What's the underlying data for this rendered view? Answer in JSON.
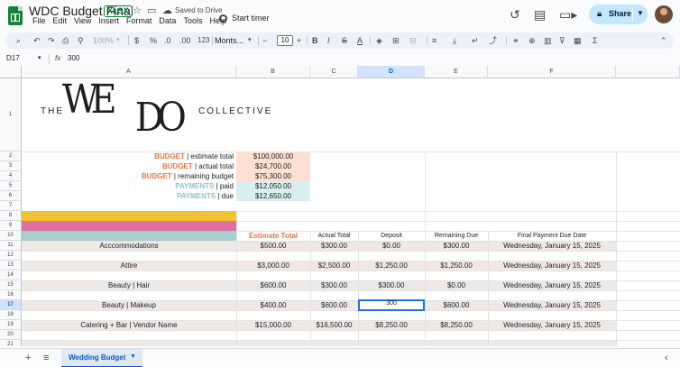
{
  "window": {
    "title": "WDC Budget Final",
    "badge": "XLSX",
    "saved_status": "Saved to Drive",
    "timer_label": "Start timer",
    "share_label": "Share"
  },
  "menu": [
    "File",
    "Edit",
    "View",
    "Insert",
    "Format",
    "Data",
    "Tools",
    "Help"
  ],
  "toolbar": {
    "zoom": "100%",
    "currency": "$",
    "percent": "%",
    "decimal_less": ".0",
    "decimal_more": ".00",
    "number_format": "123",
    "font": "Monts...",
    "font_size": "10",
    "minus": "−",
    "plus": "+"
  },
  "formula_bar": {
    "cell_ref": "D17",
    "fx": "fx",
    "value": "300"
  },
  "columns": [
    "A",
    "B",
    "C",
    "D",
    "E",
    "F"
  ],
  "rows": [
    "1",
    "2",
    "3",
    "4",
    "5",
    "6",
    "7",
    "8",
    "9",
    "10",
    "11",
    "12",
    "13",
    "14",
    "15",
    "16",
    "17",
    "18",
    "19",
    "20",
    "21"
  ],
  "logo": {
    "the": "THE",
    "we": "WE",
    "do": "DO",
    "collective": "COLLECTIVE"
  },
  "summary": [
    {
      "label_bold": "BUDGET",
      "label_rest": " | estimate total",
      "value": "$100,000.00"
    },
    {
      "label_bold": "BUDGET",
      "label_rest": " | actual total",
      "value": "$24,700.00"
    },
    {
      "label_bold": "BUDGET",
      "label_rest": " | remaining budget",
      "value": "$75,300.00"
    },
    {
      "label_bold": "PAYMENTS",
      "label_rest": " | paid",
      "value": "$12,050.00"
    },
    {
      "label_bold": "PAYMENTS",
      "label_rest": " | due",
      "value": "$12,650.00"
    }
  ],
  "table_headers": {
    "estimate": "Estimate Total",
    "actual": "Actual Total",
    "deposit": "Deposit",
    "remaining": "Remaining Due",
    "final_date": "Final Payment Due Date"
  },
  "table_rows": [
    {
      "name": "Acccommodations",
      "estimate": "$500.00",
      "actual": "$300.00",
      "deposit": "$0.00",
      "remaining": "$300.00",
      "date": "Wednesday, January 15, 2025"
    },
    {
      "name": "Attire",
      "estimate": "$3,000.00",
      "actual": "$2,500.00",
      "deposit": "$1,250.00",
      "remaining": "$1,250.00",
      "date": "Wednesday, January 15, 2025"
    },
    {
      "name": "Beauty | Hair",
      "estimate": "$600.00",
      "actual": "$300.00",
      "deposit": "$300.00",
      "remaining": "$0.00",
      "date": "Wednesday, January 15, 2025"
    },
    {
      "name": "Beauty | Makeup",
      "estimate": "$400.00",
      "actual": "$600.00",
      "deposit": "300",
      "remaining": "$600.00",
      "date": "Wednesday, January 15, 2025"
    },
    {
      "name": "Catering + Bar | Vendor Name",
      "estimate": "$15,000.00",
      "actual": "$16,500.00",
      "deposit": "$8,250.00",
      "remaining": "$8,250.00",
      "date": "Wednesday, January 15, 2025"
    }
  ],
  "sheet_tab": "Wedding Budget",
  "colors": {
    "budget_orange": "#e8743b",
    "payments_teal": "#8fc5c9",
    "budget_fill": "#fde0d2",
    "payments_fill": "#d9eeee",
    "bar_yellow": "#f1c232",
    "bar_pink": "#e06fa3",
    "bar_teal": "#a8cfcf",
    "row_stripe": "#efe9e6",
    "accent_blue": "#0b57d0"
  }
}
